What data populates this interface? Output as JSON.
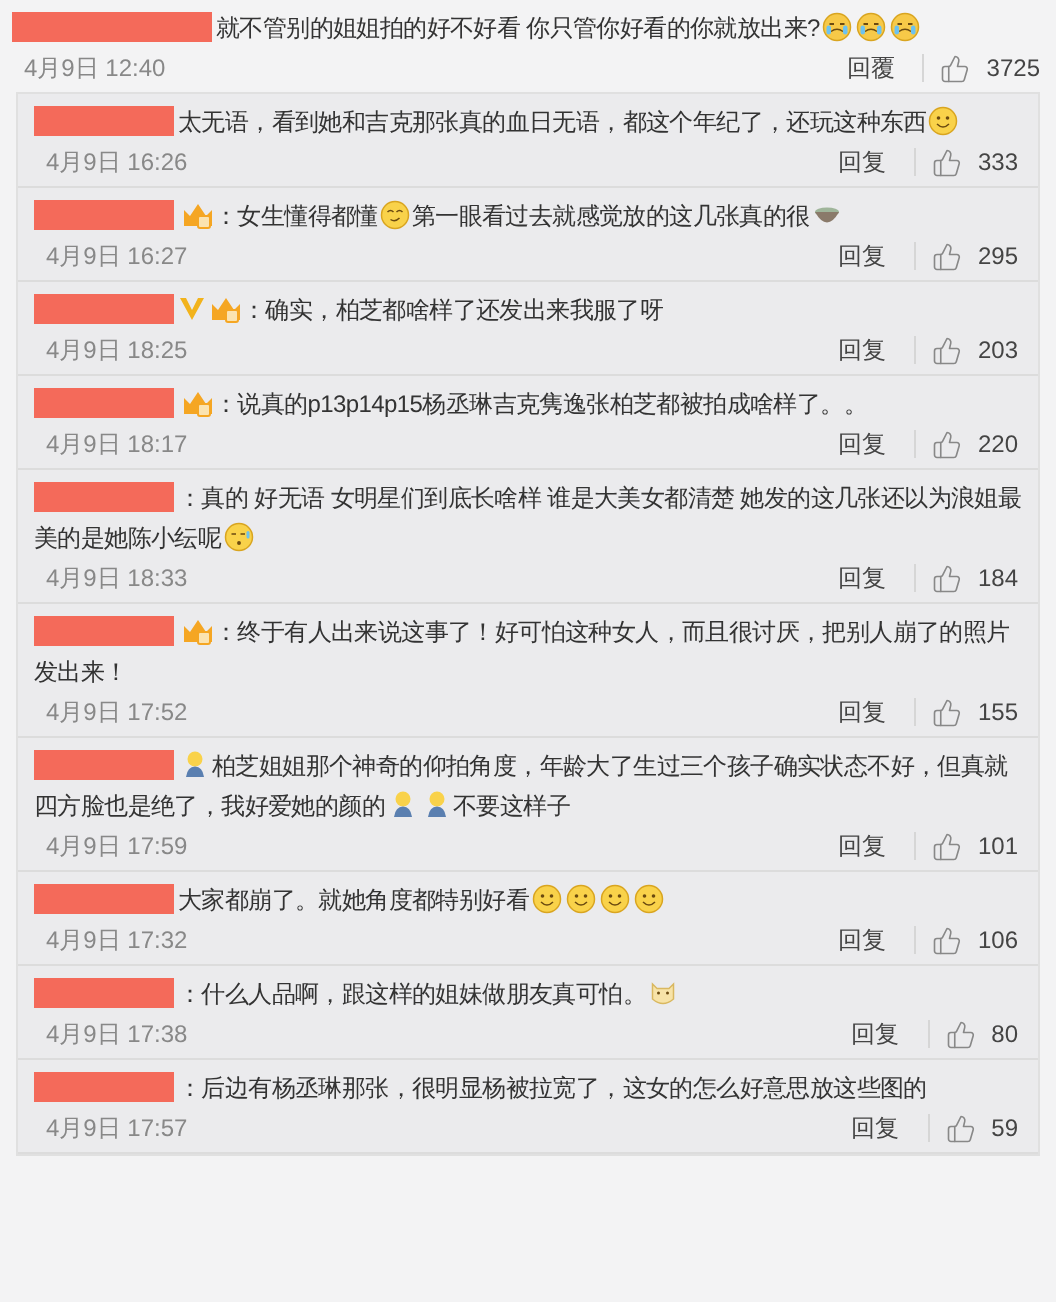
{
  "comment": {
    "content": [
      {
        "kind": "text",
        "text": "就不管别的姐姐拍的好不好看 你只管你好看的你就放出来?"
      },
      {
        "kind": "crying"
      },
      {
        "kind": "crying"
      },
      {
        "kind": "crying"
      }
    ],
    "time": "4月9日 12:40",
    "reply": "回覆",
    "likes": "3725"
  },
  "replies": [
    {
      "content": [
        {
          "kind": "text",
          "text": "太无语，看到她和吉克那张真的血日无语，都这个年纪了，还玩这种东西"
        },
        {
          "kind": "smile"
        }
      ],
      "time": "4月9日 16:26",
      "reply": "回复",
      "likes": "333"
    },
    {
      "badges": [
        {
          "kind": "member"
        }
      ],
      "content": [
        {
          "kind": "text",
          "text": "：女生懂得都懂"
        },
        {
          "kind": "smirk"
        },
        {
          "kind": "text",
          "text": "第一眼看过去就感觉放的这几张真的很"
        },
        {
          "kind": "bowl"
        }
      ],
      "time": "4月9日 16:27",
      "reply": "回复",
      "likes": "295"
    },
    {
      "badges": [
        {
          "kind": "verified"
        },
        {
          "kind": "member"
        }
      ],
      "content": [
        {
          "kind": "text",
          "text": "：确实，柏芝都啥样了还发出来我服了呀"
        }
      ],
      "time": "4月9日 18:25",
      "reply": "回复",
      "likes": "203"
    },
    {
      "badges": [
        {
          "kind": "member"
        }
      ],
      "content": [
        {
          "kind": "text",
          "text": "：说真的p13p14p15杨丞琳吉克隽逸张柏芝都被拍成啥样了。。"
        }
      ],
      "time": "4月9日 18:17",
      "reply": "回复",
      "likes": "220"
    },
    {
      "content": [
        {
          "kind": "text",
          "text": "：真的 好无语 女明星们到底长啥样 谁是大美女都清楚 她发的这几张还以为浪姐最美的是她陈小纭呢"
        },
        {
          "kind": "sweat"
        }
      ],
      "time": "4月9日 18:33",
      "reply": "回复",
      "likes": "184"
    },
    {
      "badges": [
        {
          "kind": "member"
        }
      ],
      "content": [
        {
          "kind": "text",
          "text": "：终于有人出来说这事了！好可怕这种女人，而且很讨厌，把别人崩了的照片发出来！"
        }
      ],
      "time": "4月9日 17:52",
      "reply": "回复",
      "likes": "155"
    },
    {
      "content": [
        {
          "kind": "figure"
        },
        {
          "kind": "text",
          "text": "柏芝姐姐那个神奇的仰拍角度，年龄大了生过三个孩子确实状态不好，但真就四方脸也是绝了，我好爱她的颜的"
        },
        {
          "kind": "figure"
        },
        {
          "kind": "figure"
        },
        {
          "kind": "text",
          "text": "不要这样子"
        }
      ],
      "time": "4月9日 17:59",
      "reply": "回复",
      "likes": "101"
    },
    {
      "content": [
        {
          "kind": "text",
          "text": "大家都崩了。就她角度都特别好看"
        },
        {
          "kind": "smile"
        },
        {
          "kind": "smile"
        },
        {
          "kind": "smile"
        },
        {
          "kind": "smile"
        }
      ],
      "time": "4月9日 17:32",
      "reply": "回复",
      "likes": "106"
    },
    {
      "content": [
        {
          "kind": "text",
          "text": "：什么人品啊，跟这样的姐妹做朋友真可怕。"
        },
        {
          "kind": "dog"
        }
      ],
      "time": "4月9日 17:38",
      "reply": "回复",
      "likes": "80"
    },
    {
      "content": [
        {
          "kind": "text",
          "text": "：后边有杨丞琳那张，很明显杨被拉宽了，这女的怎么好意思放这些图的"
        }
      ],
      "time": "4月9日 17:57",
      "reply": "回复",
      "likes": "59"
    }
  ]
}
